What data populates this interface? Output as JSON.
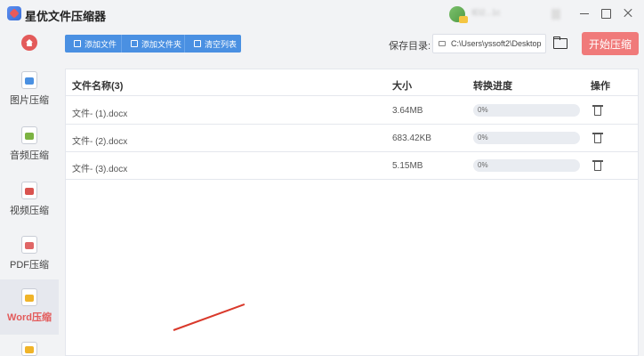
{
  "app": {
    "title": "星优文件压缩器"
  },
  "user": {
    "name": "IEl2...1c"
  },
  "sidebar": {
    "items": [
      {
        "label": "图片压缩",
        "icon": "image-file-icon",
        "color": "#4a90e2",
        "active": false
      },
      {
        "label": "音频压缩",
        "icon": "audio-file-icon",
        "color": "#7cb342",
        "active": false
      },
      {
        "label": "视频压缩",
        "icon": "video-file-icon",
        "color": "#d9534f",
        "active": false
      },
      {
        "label": "PDF压缩",
        "icon": "pdf-file-icon",
        "color": "#e06666",
        "active": false
      },
      {
        "label": "Word压缩",
        "icon": "word-file-icon",
        "color": "#f0b429",
        "active": true
      }
    ]
  },
  "toolbar": {
    "add_file": "添加文件",
    "add_folder": "添加文件夹",
    "clear_list": "清空列表",
    "save_label": "保存目录:",
    "save_path": "C:\\Users\\yssoft2\\Desktop",
    "start_button": "开始压缩"
  },
  "table": {
    "headers": {
      "name": "文件名称(3)",
      "size": "大小",
      "progress": "转换进度",
      "action": "操作"
    },
    "rows": [
      {
        "name": "文件- (1).docx",
        "size": "3.64MB",
        "progress_text": "0%",
        "progress": 0
      },
      {
        "name": "文件- (2).docx",
        "size": "683.42KB",
        "progress_text": "0%",
        "progress": 0
      },
      {
        "name": "文件- (3).docx",
        "size": "5.15MB",
        "progress_text": "0%",
        "progress": 0
      }
    ]
  },
  "colors": {
    "accent": "#4a90e2",
    "start": "#f07a7a",
    "active": "#e35a5a"
  }
}
